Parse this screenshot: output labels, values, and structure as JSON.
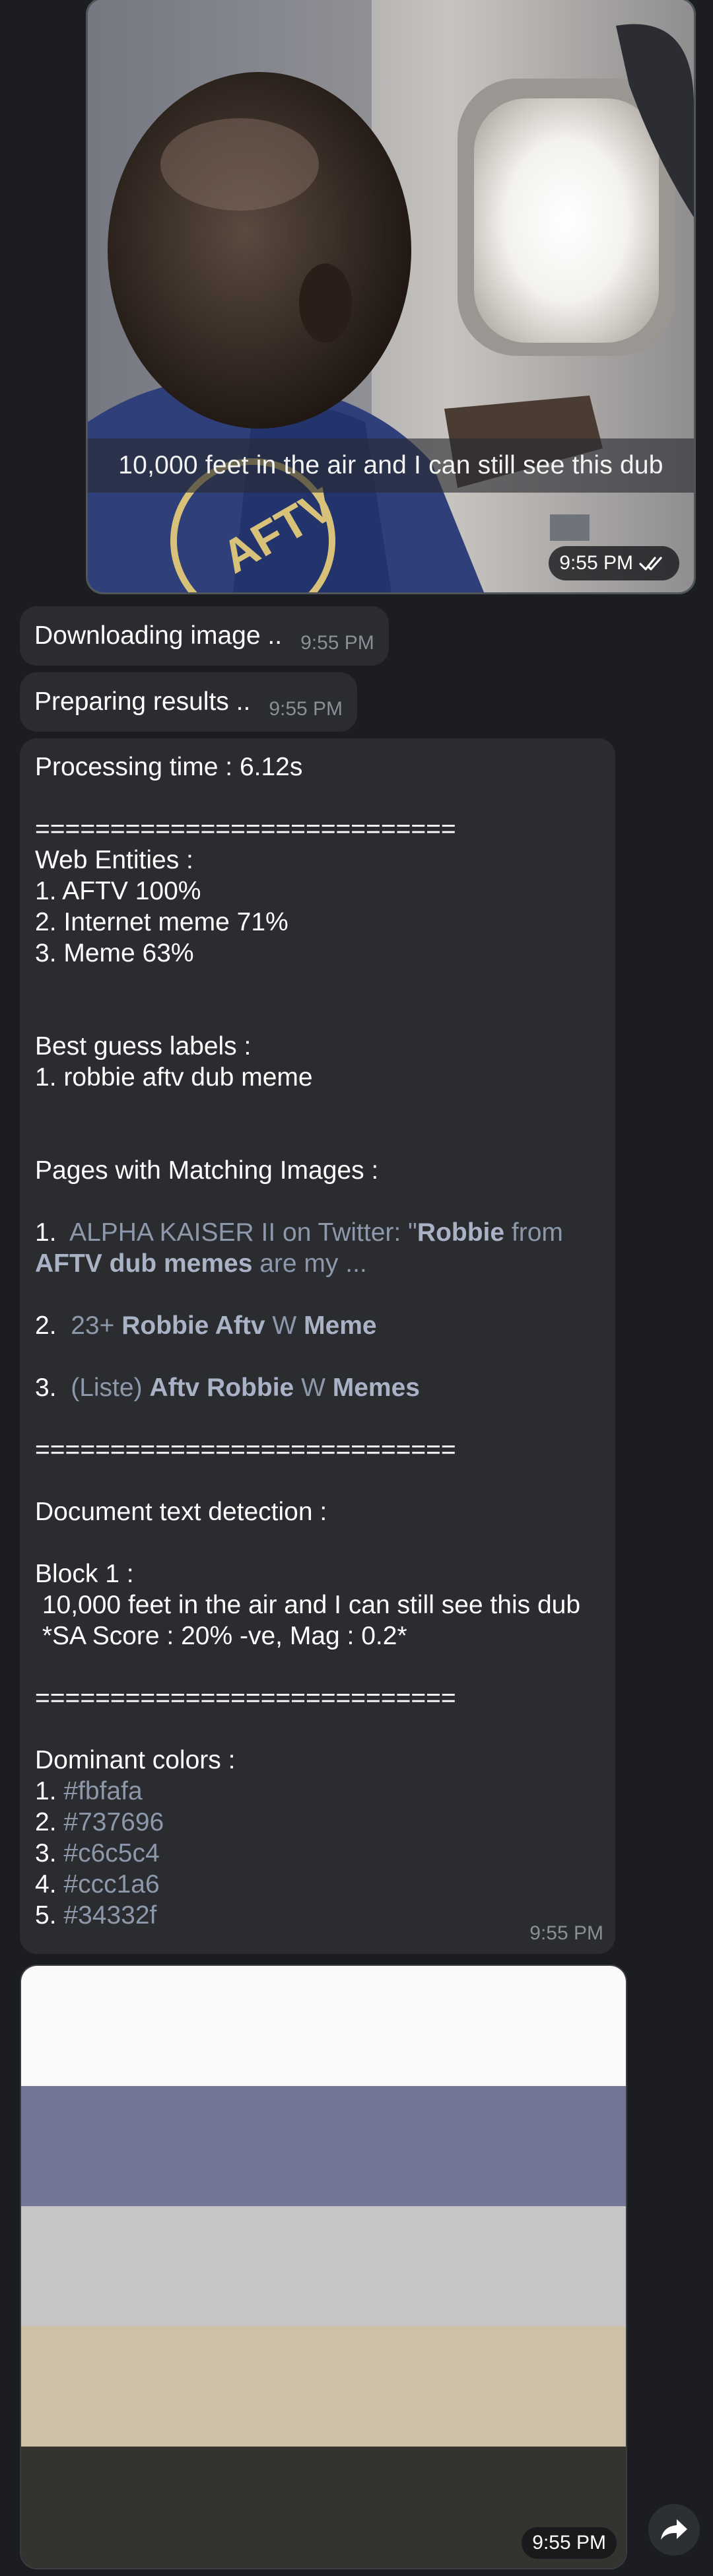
{
  "photo_message": {
    "caption": "10,000 feet in the air and I can still see this dub",
    "time": "9:55 PM",
    "read_status_icon": "double-check-icon"
  },
  "status_messages": [
    {
      "text": "Downloading image ..",
      "time": "9:55 PM"
    },
    {
      "text": "Preparing results ..",
      "time": "9:55 PM"
    }
  ],
  "results": {
    "processing_time": "Processing time : 6.12s",
    "separator": "============================",
    "web_entities_title": "Web Entities :",
    "web_entities": [
      "1. AFTV 100%",
      "2. Internet meme 71%",
      "3. Meme 63%"
    ],
    "best_guess_title": "Best guess labels :",
    "best_guess": [
      "1. robbie aftv dub meme"
    ],
    "pages_title": "Pages with Matching Images :",
    "pages": [
      {
        "num": "1.",
        "parts": [
          "ALPHA KAISER II on Twitter: \"",
          "Robbie",
          " from",
          "AFTV dub memes",
          " are my ..."
        ]
      },
      {
        "num": "2.",
        "parts": [
          "23+ ",
          "Robbie Aftv",
          " W ",
          "Meme"
        ]
      },
      {
        "num": "3.",
        "parts": [
          "(Liste) ",
          "Aftv Robbie",
          " W ",
          "Memes"
        ]
      }
    ],
    "text_detection_title": "Document text detection :",
    "block_title": "Block 1 :",
    "block_text": " 10,000 feet in the air and I can still see this dub",
    "block_sa": " *SA Score : 20% -ve, Mag : 0.2*",
    "dominant_title": "Dominant colors :",
    "dominant_colors": [
      {
        "num": "1.",
        "hex": "#fbfafa"
      },
      {
        "num": "2.",
        "hex": "#737696"
      },
      {
        "num": "3.",
        "hex": "#c6c5c4"
      },
      {
        "num": "4.",
        "hex": "#ccc1a6"
      },
      {
        "num": "5.",
        "hex": "#34332f"
      }
    ],
    "time": "9:55 PM"
  },
  "colors_message": {
    "swatches": [
      "#fbfafa",
      "#737696",
      "#c6c5c4",
      "#ccc1a6",
      "#34332f"
    ],
    "time": "9:55 PM"
  },
  "share_button_icon": "share-arrow-icon",
  "colors": {
    "background": "#1b1d20",
    "bubble": "#2a2c30",
    "link": "#8d98ab",
    "time_text": "#8a8f96"
  }
}
